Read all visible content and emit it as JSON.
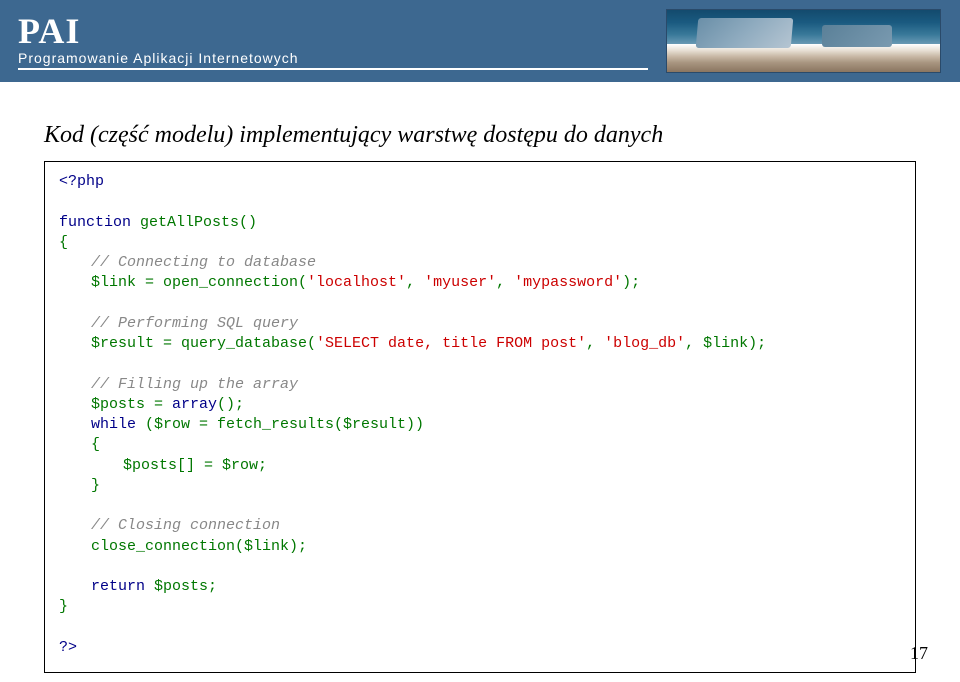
{
  "header": {
    "title": "PAI",
    "subtitle": "Programowanie Aplikacji Internetowych"
  },
  "slide": {
    "title": "Kod (część modelu) implementujący warstwę dostępu do danych"
  },
  "code": {
    "l1": "<?php",
    "l2a": "function",
    "l2b": " getAllPosts()",
    "l3": "{",
    "l4": "// Connecting to database",
    "l5a": "$link = open_connection(",
    "l5b": "'localhost'",
    "l5c": ", ",
    "l5d": "'myuser'",
    "l5e": ", ",
    "l5f": "'mypassword'",
    "l5g": ");",
    "l6": "// Performing SQL query",
    "l7a": "$result = query_database(",
    "l7b": "'SELECT date, title FROM post'",
    "l7c": ", ",
    "l7d": "'blog_db'",
    "l7e": ", $link);",
    "l8": "// Filling up the array",
    "l9a": "$posts = ",
    "l9b": "array",
    "l9c": "();",
    "l10a": "while",
    "l10b": " ($row = fetch_results($result))",
    "l11": "{",
    "l12": "$posts[] = $row;",
    "l13": "}",
    "l14": "// Closing connection",
    "l15": "close_connection($link);",
    "l16a": "return",
    "l16b": " $posts;",
    "l17": "}",
    "l18": "?>"
  },
  "page_number": "17"
}
